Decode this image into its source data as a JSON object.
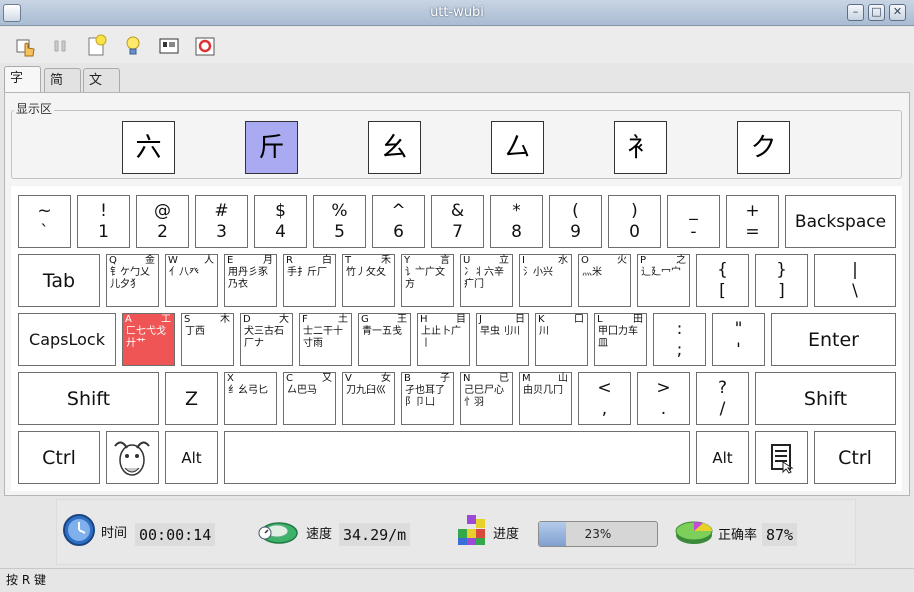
{
  "window": {
    "title": "utt-wubi",
    "minimize_glyph": "–",
    "maximize_glyph": "□",
    "close_glyph": "✕"
  },
  "toolbar": {
    "icons": [
      "hand-pointer-icon",
      "pause-icon",
      "new-document-icon",
      "lightbulb-icon",
      "keyboard-settings-icon",
      "help-lifebuoy-icon"
    ]
  },
  "tabs": [
    {
      "label": "字根",
      "active": true
    },
    {
      "label": "简码",
      "active": false
    },
    {
      "label": "文章",
      "active": false
    }
  ],
  "display": {
    "label": "显示区",
    "roots": [
      {
        "char": "六",
        "highlighted": false
      },
      {
        "char": "斤",
        "highlighted": true
      },
      {
        "char": "幺",
        "highlighted": false
      },
      {
        "char": "厶",
        "highlighted": false
      },
      {
        "char": "衤",
        "highlighted": false
      },
      {
        "char": "ク",
        "highlighted": false
      }
    ]
  },
  "keyboard": {
    "row1": [
      {
        "top": "~",
        "bottom": "`"
      },
      {
        "top": "!",
        "bottom": "1"
      },
      {
        "top": "@",
        "bottom": "2"
      },
      {
        "top": "#",
        "bottom": "3"
      },
      {
        "top": "$",
        "bottom": "4"
      },
      {
        "top": "%",
        "bottom": "5"
      },
      {
        "top": "^",
        "bottom": "6"
      },
      {
        "top": "&",
        "bottom": "7"
      },
      {
        "top": "*",
        "bottom": "8"
      },
      {
        "top": "(",
        "bottom": "9"
      },
      {
        "top": ")",
        "bottom": "0"
      },
      {
        "top": "_",
        "bottom": "-"
      },
      {
        "top": "+",
        "bottom": "="
      }
    ],
    "backspace": "Backspace",
    "tab": "Tab",
    "row2": [
      {
        "letter": "Q",
        "radical": "金",
        "glyphs": "钅ケ勹乂儿夕犭"
      },
      {
        "letter": "W",
        "radical": "人",
        "glyphs": "亻八癶"
      },
      {
        "letter": "E",
        "radical": "月",
        "glyphs": "用丹彡豕乃衣"
      },
      {
        "letter": "R",
        "radical": "白",
        "glyphs": "手扌斤厂"
      },
      {
        "letter": "T",
        "radical": "禾",
        "glyphs": "竹丿攵夂"
      },
      {
        "letter": "Y",
        "radical": "言",
        "glyphs": "讠亠广文方"
      },
      {
        "letter": "U",
        "radical": "立",
        "glyphs": "冫丬六辛疒门"
      },
      {
        "letter": "I",
        "radical": "水",
        "glyphs": "氵小兴"
      },
      {
        "letter": "O",
        "radical": "火",
        "glyphs": "灬米"
      },
      {
        "letter": "P",
        "radical": "之",
        "glyphs": "辶廴冖宀"
      }
    ],
    "row2_punct": [
      {
        "top": "{",
        "bottom": "["
      },
      {
        "top": "}",
        "bottom": "]"
      },
      {
        "top": "|",
        "bottom": "\\"
      }
    ],
    "capslock": "CapsLock",
    "row3": [
      {
        "letter": "A",
        "radical": "工",
        "glyphs": "匚七弋戈廾艹",
        "highlighted": true
      },
      {
        "letter": "S",
        "radical": "木",
        "glyphs": "丁西"
      },
      {
        "letter": "D",
        "radical": "大",
        "glyphs": "犬三古石厂ナ"
      },
      {
        "letter": "F",
        "radical": "土",
        "glyphs": "士二干十寸雨"
      },
      {
        "letter": "G",
        "radical": "王",
        "glyphs": "青一五戋"
      },
      {
        "letter": "H",
        "radical": "目",
        "glyphs": "上止卜广丨"
      },
      {
        "letter": "J",
        "radical": "日",
        "glyphs": "早虫刂川"
      },
      {
        "letter": "K",
        "radical": "口",
        "glyphs": "川"
      },
      {
        "letter": "L",
        "radical": "田",
        "glyphs": "甲囗力车皿"
      }
    ],
    "row3_punct": [
      {
        "top": ":",
        "bottom": ";"
      },
      {
        "top": "\"",
        "bottom": "'"
      }
    ],
    "enter": "Enter",
    "shift_left": "Shift",
    "z": "Z",
    "row4": [
      {
        "letter": "X",
        "radical": "",
        "glyphs": "纟幺弓匕"
      },
      {
        "letter": "C",
        "radical": "又",
        "glyphs": "厶巴马"
      },
      {
        "letter": "V",
        "radical": "女",
        "glyphs": "刀九臼巛"
      },
      {
        "letter": "B",
        "radical": "子",
        "glyphs": "孑也耳了阝卩凵"
      },
      {
        "letter": "N",
        "radical": "已",
        "glyphs": "己巳尸心忄羽"
      },
      {
        "letter": "M",
        "radical": "山",
        "glyphs": "由贝几冂"
      }
    ],
    "row4_punct": [
      {
        "top": "<",
        "bottom": ","
      },
      {
        "top": ">",
        "bottom": "."
      },
      {
        "top": "?",
        "bottom": "/"
      }
    ],
    "shift_right": "Shift",
    "ctrl_left": "Ctrl",
    "alt_left": "Alt",
    "alt_right": "Alt",
    "ctrl_right": "Ctrl"
  },
  "stats": {
    "time_label": "时间",
    "time_value": "00:00:14",
    "speed_label": "速度",
    "speed_value": "34.29/m",
    "progress_label": "进度",
    "progress_text": "23%",
    "progress_fraction": 0.23,
    "accuracy_label": "正确率",
    "accuracy_value": "87%"
  },
  "statusbar": {
    "text": "按 R 键"
  }
}
